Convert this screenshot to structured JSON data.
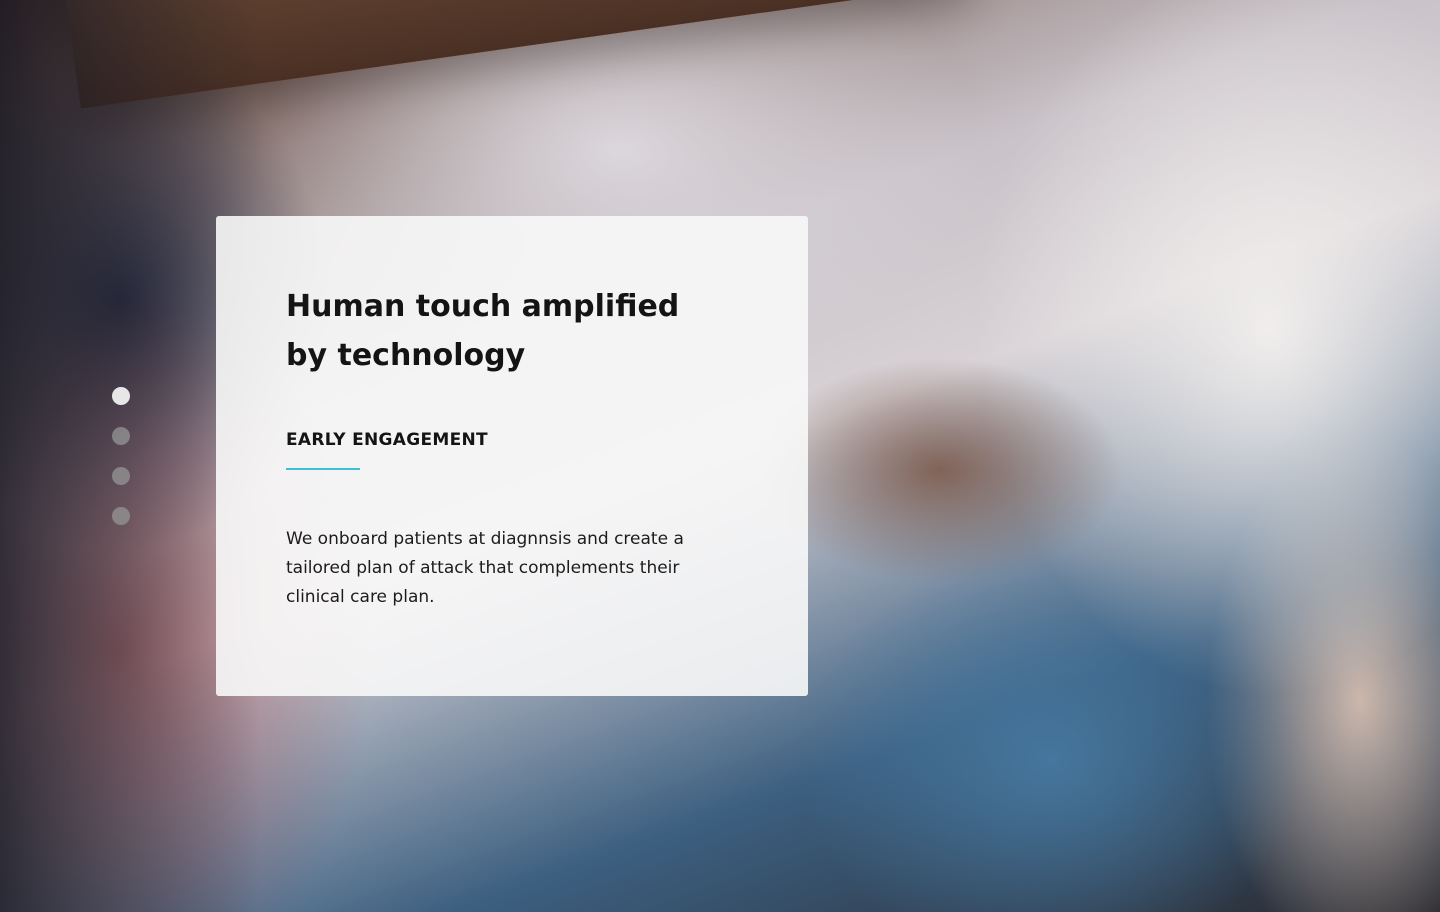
{
  "hero": {
    "title": "Human touch amplified by technology",
    "section_label": "EARLY ENGAGEMENT",
    "description": "We onboard patients at diagnnsis and create a tailored plan of attack that complements their clinical care plan."
  },
  "pager": {
    "count": 4,
    "active_index": 0
  },
  "colors": {
    "accent": "#3cc0d6",
    "text": "#141414",
    "card_background": "#f8f8f8"
  }
}
